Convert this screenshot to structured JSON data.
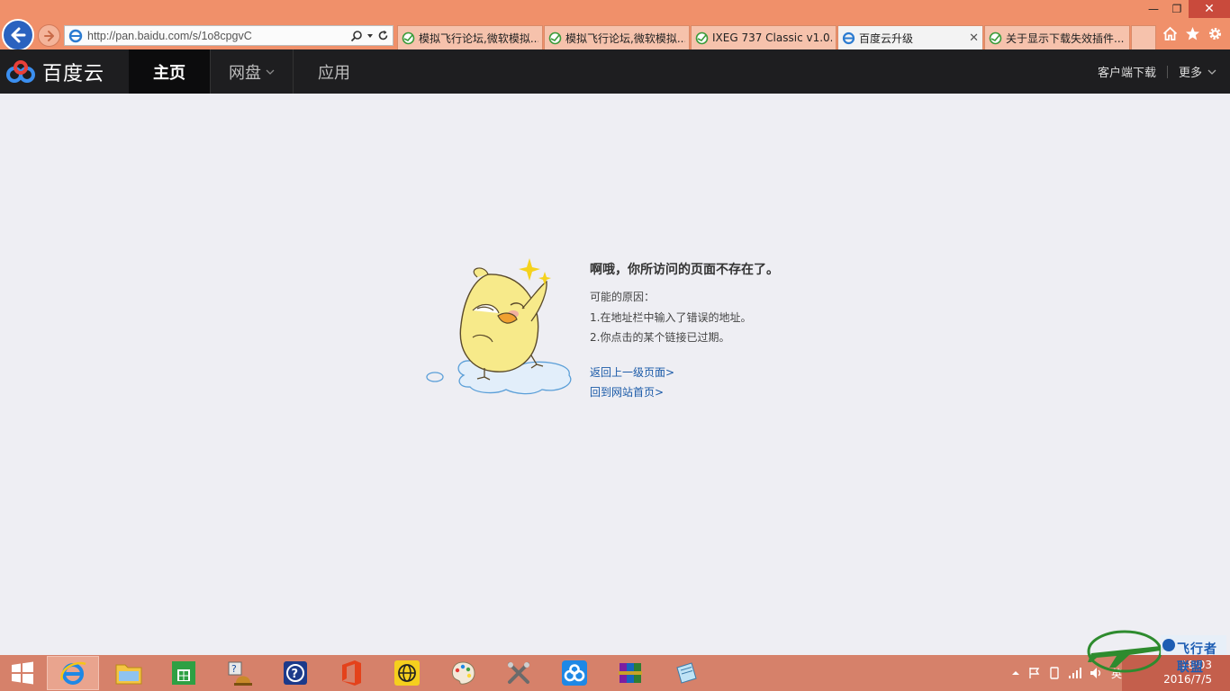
{
  "window": {
    "minimize": "—",
    "restore": "❐",
    "close": "✕"
  },
  "address_bar": {
    "url": "http://pan.baidu.com/s/1o8cpgvC"
  },
  "tabs": [
    {
      "title": "模拟飞行论坛,微软模拟...",
      "active": false
    },
    {
      "title": "模拟飞行论坛,微软模拟...",
      "active": false
    },
    {
      "title": "IXEG 737 Classic v1.0....",
      "active": false
    },
    {
      "title": "百度云升级",
      "active": true
    },
    {
      "title": "关于显示下载失效插件...",
      "active": false
    }
  ],
  "site": {
    "logo_text": "百度云",
    "nav": {
      "home": "主页",
      "netdisk": "网盘",
      "apps": "应用"
    },
    "client_download": "客户端下载",
    "more": "更多"
  },
  "error": {
    "title": "啊哦，你所访问的页面不存在了。",
    "reasons_label": "可能的原因：",
    "reason_1": "1.在地址栏中输入了错误的地址。",
    "reason_2": "2.你点击的某个链接已过期。",
    "link_back": "返回上一级页面>",
    "link_home": "回到网站首页>"
  },
  "taskbar": {
    "ime": "英",
    "time": "18:03",
    "date": "2016/7/5"
  },
  "watermark": {
    "text": "飞行者联盟"
  },
  "colors": {
    "chrome": "#f0906a",
    "header_bg": "#1e1e20",
    "page_bg": "#eeeef3",
    "link": "#1a5aa8",
    "taskbar": "#d6816a"
  }
}
